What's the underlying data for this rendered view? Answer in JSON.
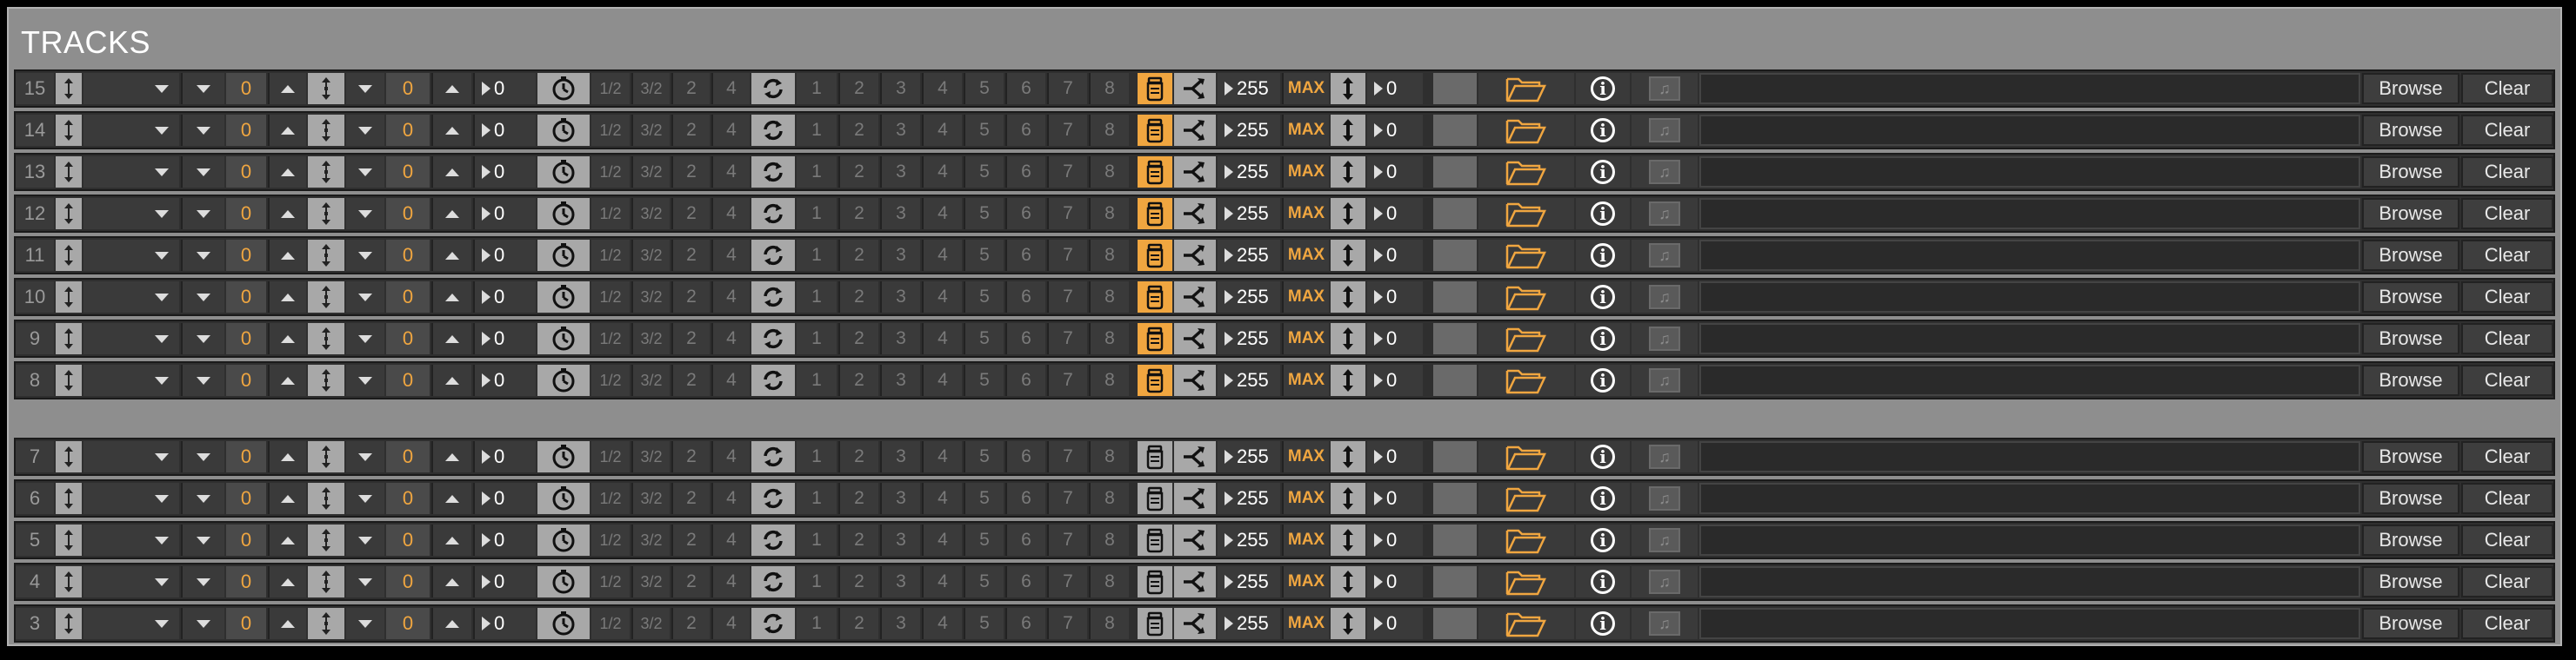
{
  "title": "TRACKS",
  "colors": {
    "accent": "#f0a640",
    "panel": "#8e8e8e",
    "row": "#2f2f2f"
  },
  "row_labels": {
    "initial_a": "0",
    "initial_b": "0",
    "arrow_value": "0",
    "half": "1/2",
    "three_half": "3/2",
    "two": "2",
    "four": "4",
    "steps": [
      "1",
      "2",
      "3",
      "4",
      "5",
      "6",
      "7",
      "8"
    ],
    "level": "255",
    "max": "MAX",
    "offset": "0",
    "browse": "Browse",
    "clear": "Clear"
  },
  "icons": [
    "vertical-arrows-icon",
    "dropdown-icon",
    "up-triangle-icon",
    "timer-icon",
    "loop-icon",
    "jar-icon",
    "split-icon",
    "folder-icon",
    "info-icon",
    "music-note-icon"
  ],
  "groups": [
    {
      "tracks": [
        {
          "number": "15",
          "jar_active": true
        },
        {
          "number": "14",
          "jar_active": true
        },
        {
          "number": "13",
          "jar_active": true
        },
        {
          "number": "12",
          "jar_active": true
        },
        {
          "number": "11",
          "jar_active": true
        },
        {
          "number": "10",
          "jar_active": true
        },
        {
          "number": "9",
          "jar_active": true
        },
        {
          "number": "8",
          "jar_active": true
        }
      ]
    },
    {
      "tracks": [
        {
          "number": "7",
          "jar_active": false
        },
        {
          "number": "6",
          "jar_active": false
        },
        {
          "number": "5",
          "jar_active": false
        },
        {
          "number": "4",
          "jar_active": false
        },
        {
          "number": "3",
          "jar_active": false
        }
      ]
    }
  ]
}
